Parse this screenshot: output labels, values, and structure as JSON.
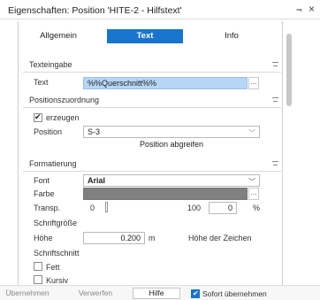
{
  "window": {
    "title": "Eigenschaften: Position 'HITE-2 - Hilfstext'",
    "pin_icon": "pin-icon",
    "close_icon": "close-icon"
  },
  "tabs": [
    {
      "label": "Allgemein",
      "active": false
    },
    {
      "label": "Text",
      "active": true
    },
    {
      "label": "Info",
      "active": false
    }
  ],
  "accent_color": "#1874cd",
  "texteingabe": {
    "header": "Texteingabe",
    "text_label": "Text",
    "text_value": "%%Querschnitt%%",
    "more": "..."
  },
  "positionszuordnung": {
    "header": "Positionszuordnung",
    "erzeugen_label": "erzeugen",
    "erzeugen_checked": true,
    "position_label": "Position",
    "position_value": "S-3",
    "grab_button": "Position abgreifen"
  },
  "formatierung": {
    "header": "Formatierung",
    "font_label": "Font",
    "font_value": "Arial",
    "farbe_label": "Farbe",
    "farbe_color": "#808080",
    "more": "...",
    "transp_label": "Transp.",
    "transp_min": "0",
    "transp_max": "100",
    "transp_value": "0",
    "transp_unit": "%",
    "schriftgroesse_label": "Schriftgröße",
    "hoehe_label": "Höhe",
    "hoehe_value": "0.200",
    "hoehe_unit": "m",
    "hoehe_desc": "Höhe der Zeichen",
    "schriftschnitt_label": "Schriftschnitt",
    "fett_label": "Fett",
    "kursiv_label": "Kursiv"
  },
  "footer": {
    "uebernehmen": "Übernehmen",
    "verwerfen": "Verwerfen",
    "hilfe": "Hilfe",
    "sofort_label": "Sofort übernehmen",
    "sofort_checked": true
  }
}
